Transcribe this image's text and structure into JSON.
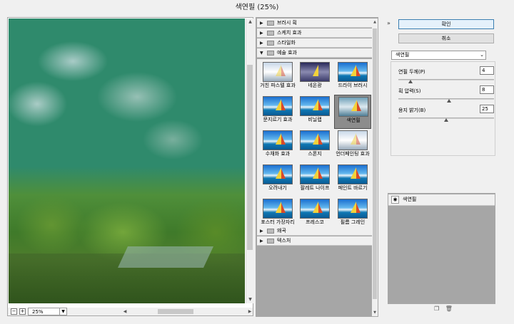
{
  "window": {
    "title": "색연필 (25%)"
  },
  "preview": {
    "zoom": "25%"
  },
  "categories_top": [
    {
      "label": "브러시 획",
      "expanded": false
    },
    {
      "label": "스케치 효과",
      "expanded": false
    },
    {
      "label": "스타일화",
      "expanded": false
    },
    {
      "label": "예술 효과",
      "expanded": true
    }
  ],
  "thumbnails": [
    {
      "label": "거친 파스텔 효과",
      "selected": false
    },
    {
      "label": "네온광",
      "selected": false
    },
    {
      "label": "드라이 브러시",
      "selected": false
    },
    {
      "label": "문지르기 효과",
      "selected": false
    },
    {
      "label": "비닐랩",
      "selected": false
    },
    {
      "label": "색연필",
      "selected": true
    },
    {
      "label": "수채화 효과",
      "selected": false
    },
    {
      "label": "스폰지",
      "selected": false
    },
    {
      "label": "언더페인팅 효과",
      "selected": false
    },
    {
      "label": "오려내기",
      "selected": false
    },
    {
      "label": "팔레트 나이프",
      "selected": false
    },
    {
      "label": "페인트 바르기",
      "selected": false
    },
    {
      "label": "포스터 가장자리",
      "selected": false
    },
    {
      "label": "프레스코",
      "selected": false
    },
    {
      "label": "필름 그레인",
      "selected": false
    }
  ],
  "categories_bottom": [
    {
      "label": "왜곡"
    },
    {
      "label": "텍스처"
    }
  ],
  "buttons": {
    "ok": "확인",
    "cancel": "취소"
  },
  "filter_select": {
    "value": "색연필"
  },
  "params": [
    {
      "label": "연필 두께(P)",
      "value": "4",
      "fraction": 0.125
    },
    {
      "label": "획 압력(S)",
      "value": "8",
      "fraction": 0.533
    },
    {
      "label": "용지 밝기(B)",
      "value": "25",
      "fraction": 0.5
    }
  ],
  "layers": [
    {
      "name": "색연필"
    }
  ],
  "icons": {
    "collapse": "double-chevron-up-icon",
    "eye": "eye-icon",
    "new": "new-layer-icon",
    "delete": "trash-icon"
  },
  "colors": {
    "preview_bg": "#2f8a6c",
    "selected_thumb": "#8c8c8c",
    "primary_border": "#3c7fb1"
  }
}
